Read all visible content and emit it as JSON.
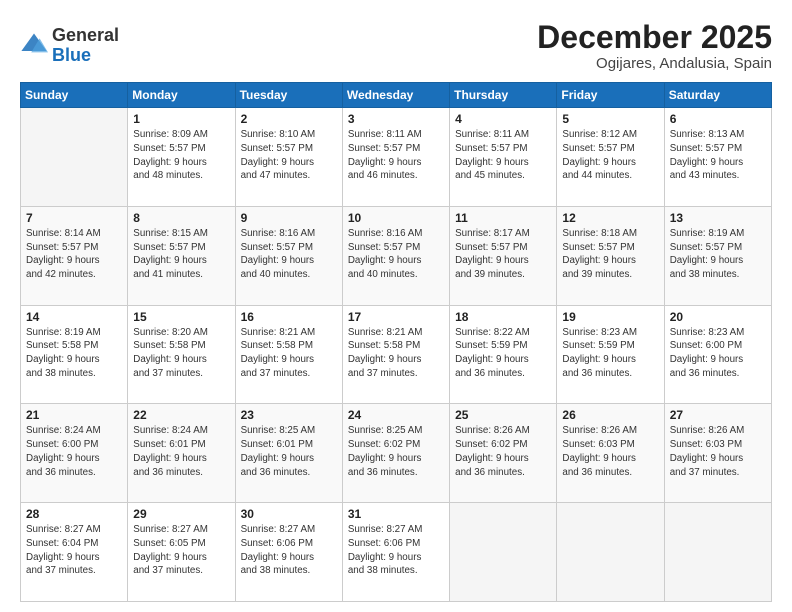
{
  "header": {
    "logo": {
      "general": "General",
      "blue": "Blue"
    },
    "title": "December 2025",
    "subtitle": "Ogijares, Andalusia, Spain"
  },
  "calendar": {
    "days_of_week": [
      "Sunday",
      "Monday",
      "Tuesday",
      "Wednesday",
      "Thursday",
      "Friday",
      "Saturday"
    ],
    "weeks": [
      [
        {
          "day": "",
          "info": ""
        },
        {
          "day": "1",
          "info": "Sunrise: 8:09 AM\nSunset: 5:57 PM\nDaylight: 9 hours\nand 48 minutes."
        },
        {
          "day": "2",
          "info": "Sunrise: 8:10 AM\nSunset: 5:57 PM\nDaylight: 9 hours\nand 47 minutes."
        },
        {
          "day": "3",
          "info": "Sunrise: 8:11 AM\nSunset: 5:57 PM\nDaylight: 9 hours\nand 46 minutes."
        },
        {
          "day": "4",
          "info": "Sunrise: 8:11 AM\nSunset: 5:57 PM\nDaylight: 9 hours\nand 45 minutes."
        },
        {
          "day": "5",
          "info": "Sunrise: 8:12 AM\nSunset: 5:57 PM\nDaylight: 9 hours\nand 44 minutes."
        },
        {
          "day": "6",
          "info": "Sunrise: 8:13 AM\nSunset: 5:57 PM\nDaylight: 9 hours\nand 43 minutes."
        }
      ],
      [
        {
          "day": "7",
          "info": "Sunrise: 8:14 AM\nSunset: 5:57 PM\nDaylight: 9 hours\nand 42 minutes."
        },
        {
          "day": "8",
          "info": "Sunrise: 8:15 AM\nSunset: 5:57 PM\nDaylight: 9 hours\nand 41 minutes."
        },
        {
          "day": "9",
          "info": "Sunrise: 8:16 AM\nSunset: 5:57 PM\nDaylight: 9 hours\nand 40 minutes."
        },
        {
          "day": "10",
          "info": "Sunrise: 8:16 AM\nSunset: 5:57 PM\nDaylight: 9 hours\nand 40 minutes."
        },
        {
          "day": "11",
          "info": "Sunrise: 8:17 AM\nSunset: 5:57 PM\nDaylight: 9 hours\nand 39 minutes."
        },
        {
          "day": "12",
          "info": "Sunrise: 8:18 AM\nSunset: 5:57 PM\nDaylight: 9 hours\nand 39 minutes."
        },
        {
          "day": "13",
          "info": "Sunrise: 8:19 AM\nSunset: 5:57 PM\nDaylight: 9 hours\nand 38 minutes."
        }
      ],
      [
        {
          "day": "14",
          "info": "Sunrise: 8:19 AM\nSunset: 5:58 PM\nDaylight: 9 hours\nand 38 minutes."
        },
        {
          "day": "15",
          "info": "Sunrise: 8:20 AM\nSunset: 5:58 PM\nDaylight: 9 hours\nand 37 minutes."
        },
        {
          "day": "16",
          "info": "Sunrise: 8:21 AM\nSunset: 5:58 PM\nDaylight: 9 hours\nand 37 minutes."
        },
        {
          "day": "17",
          "info": "Sunrise: 8:21 AM\nSunset: 5:58 PM\nDaylight: 9 hours\nand 37 minutes."
        },
        {
          "day": "18",
          "info": "Sunrise: 8:22 AM\nSunset: 5:59 PM\nDaylight: 9 hours\nand 36 minutes."
        },
        {
          "day": "19",
          "info": "Sunrise: 8:23 AM\nSunset: 5:59 PM\nDaylight: 9 hours\nand 36 minutes."
        },
        {
          "day": "20",
          "info": "Sunrise: 8:23 AM\nSunset: 6:00 PM\nDaylight: 9 hours\nand 36 minutes."
        }
      ],
      [
        {
          "day": "21",
          "info": "Sunrise: 8:24 AM\nSunset: 6:00 PM\nDaylight: 9 hours\nand 36 minutes."
        },
        {
          "day": "22",
          "info": "Sunrise: 8:24 AM\nSunset: 6:01 PM\nDaylight: 9 hours\nand 36 minutes."
        },
        {
          "day": "23",
          "info": "Sunrise: 8:25 AM\nSunset: 6:01 PM\nDaylight: 9 hours\nand 36 minutes."
        },
        {
          "day": "24",
          "info": "Sunrise: 8:25 AM\nSunset: 6:02 PM\nDaylight: 9 hours\nand 36 minutes."
        },
        {
          "day": "25",
          "info": "Sunrise: 8:26 AM\nSunset: 6:02 PM\nDaylight: 9 hours\nand 36 minutes."
        },
        {
          "day": "26",
          "info": "Sunrise: 8:26 AM\nSunset: 6:03 PM\nDaylight: 9 hours\nand 36 minutes."
        },
        {
          "day": "27",
          "info": "Sunrise: 8:26 AM\nSunset: 6:03 PM\nDaylight: 9 hours\nand 37 minutes."
        }
      ],
      [
        {
          "day": "28",
          "info": "Sunrise: 8:27 AM\nSunset: 6:04 PM\nDaylight: 9 hours\nand 37 minutes."
        },
        {
          "day": "29",
          "info": "Sunrise: 8:27 AM\nSunset: 6:05 PM\nDaylight: 9 hours\nand 37 minutes."
        },
        {
          "day": "30",
          "info": "Sunrise: 8:27 AM\nSunset: 6:06 PM\nDaylight: 9 hours\nand 38 minutes."
        },
        {
          "day": "31",
          "info": "Sunrise: 8:27 AM\nSunset: 6:06 PM\nDaylight: 9 hours\nand 38 minutes."
        },
        {
          "day": "",
          "info": ""
        },
        {
          "day": "",
          "info": ""
        },
        {
          "day": "",
          "info": ""
        }
      ]
    ]
  }
}
